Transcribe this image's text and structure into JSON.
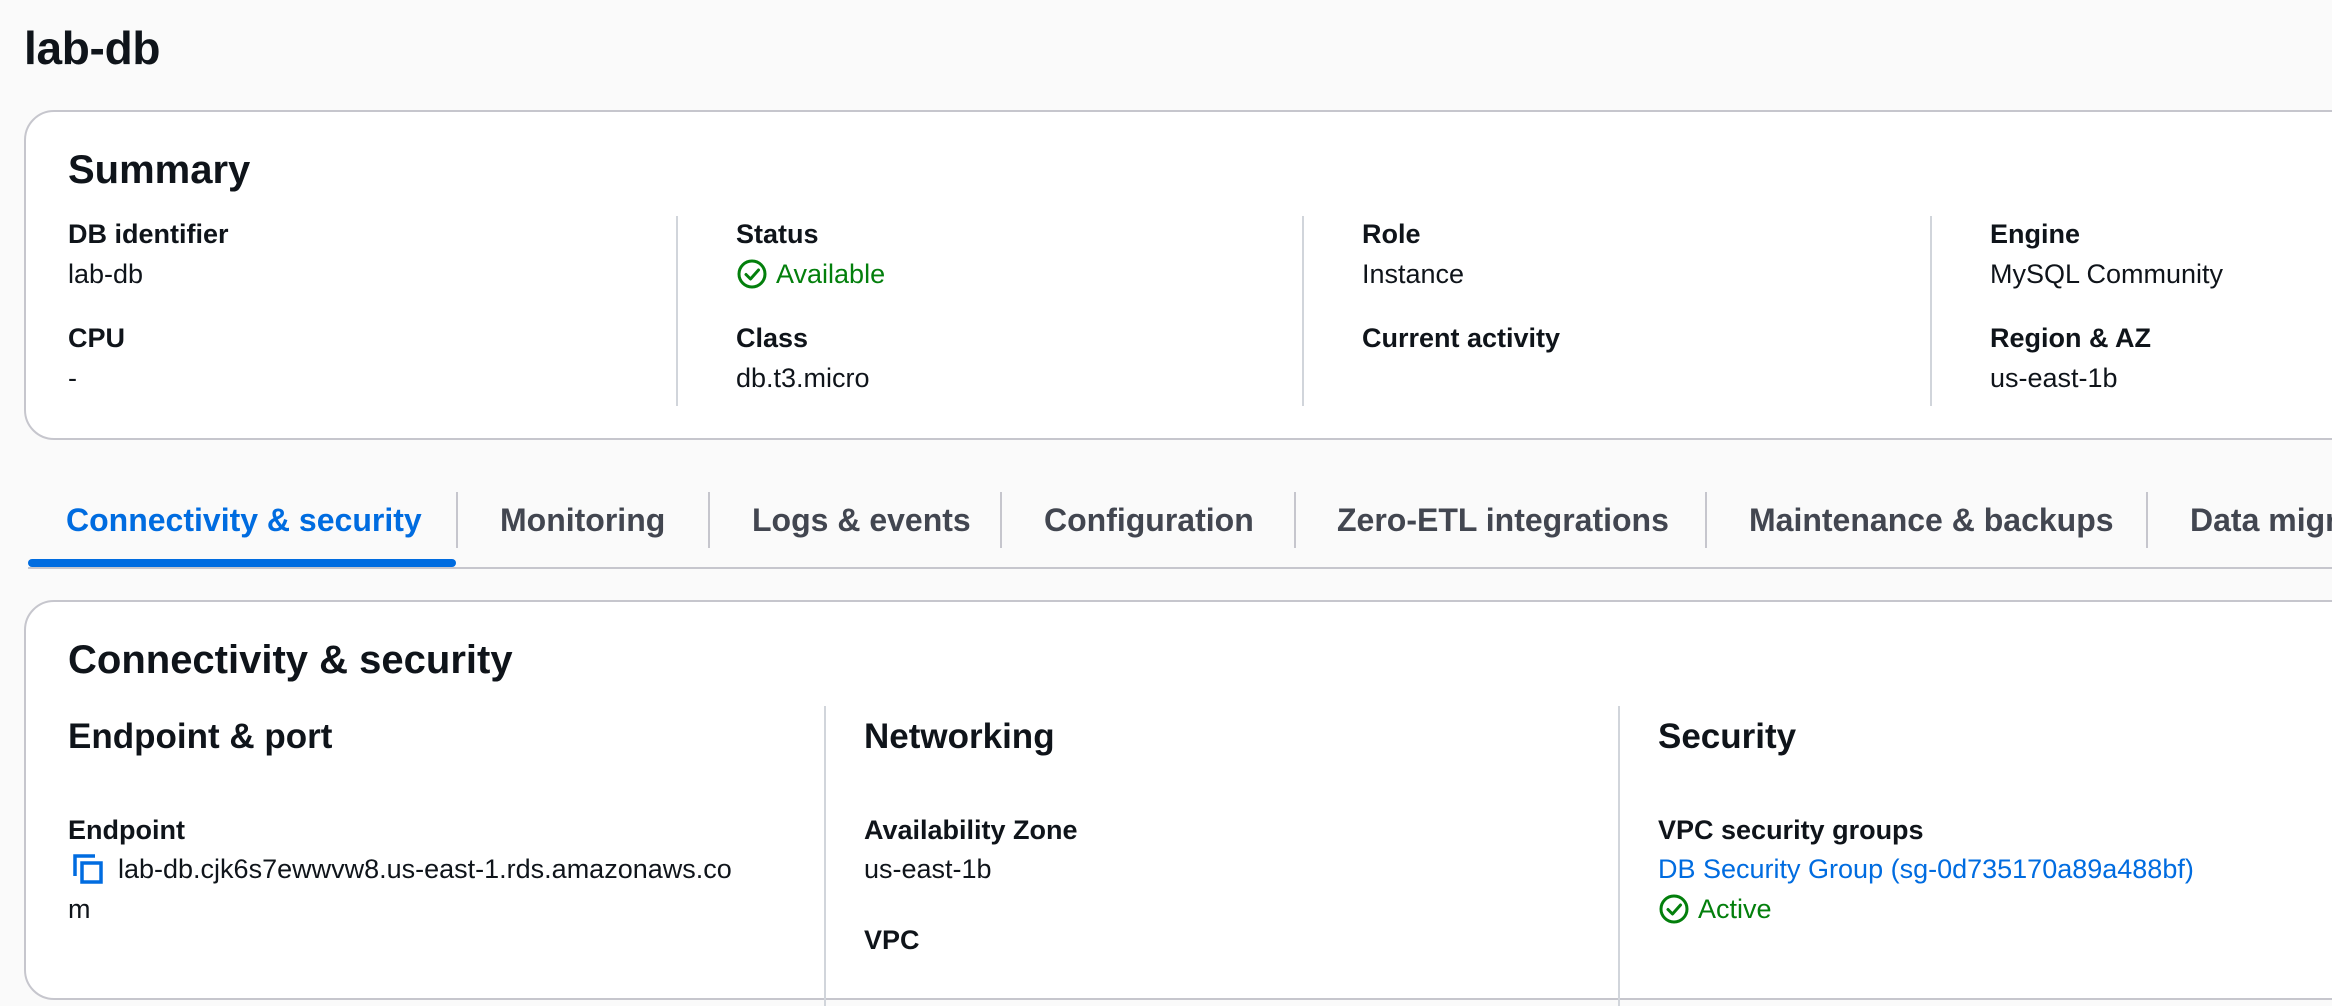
{
  "page": {
    "title": "lab-db"
  },
  "summary": {
    "title": "Summary",
    "db_identifier": {
      "label": "DB identifier",
      "value": "lab-db"
    },
    "cpu": {
      "label": "CPU",
      "value": "-"
    },
    "status": {
      "label": "Status",
      "value": "Available"
    },
    "class": {
      "label": "Class",
      "value": "db.t3.micro"
    },
    "role": {
      "label": "Role",
      "value": "Instance"
    },
    "current_activity": {
      "label": "Current activity",
      "value": ""
    },
    "engine": {
      "label": "Engine",
      "value": "MySQL Community"
    },
    "region": {
      "label": "Region & AZ",
      "value": "us-east-1b"
    }
  },
  "tabs": [
    {
      "label": "Connectivity & security",
      "active": true
    },
    {
      "label": "Monitoring"
    },
    {
      "label": "Logs & events"
    },
    {
      "label": "Configuration"
    },
    {
      "label": "Zero-ETL integrations"
    },
    {
      "label": "Maintenance & backups"
    },
    {
      "label": "Data migr"
    }
  ],
  "connectivity": {
    "title": "Connectivity & security",
    "endpoint_section": {
      "title": "Endpoint & port",
      "endpoint_label": "Endpoint",
      "endpoint_line1": "lab-db.cjk6s7ewwvw8.us-east-1.rds.amazonaws.co",
      "endpoint_line2": "m"
    },
    "networking_section": {
      "title": "Networking",
      "az_label": "Availability Zone",
      "az_value": "us-east-1b",
      "vpc_label": "VPC"
    },
    "security_section": {
      "title": "Security",
      "sg_label": "VPC security groups",
      "sg_link": "DB Security Group (sg-0d735170a89a488bf)",
      "sg_status": "Active"
    }
  },
  "colors": {
    "accent": "#006ce0",
    "success": "#037f0c",
    "border": "#c6c6cd"
  },
  "icons": [
    "status-available-icon",
    "copy-icon",
    "sg-active-icon"
  ]
}
